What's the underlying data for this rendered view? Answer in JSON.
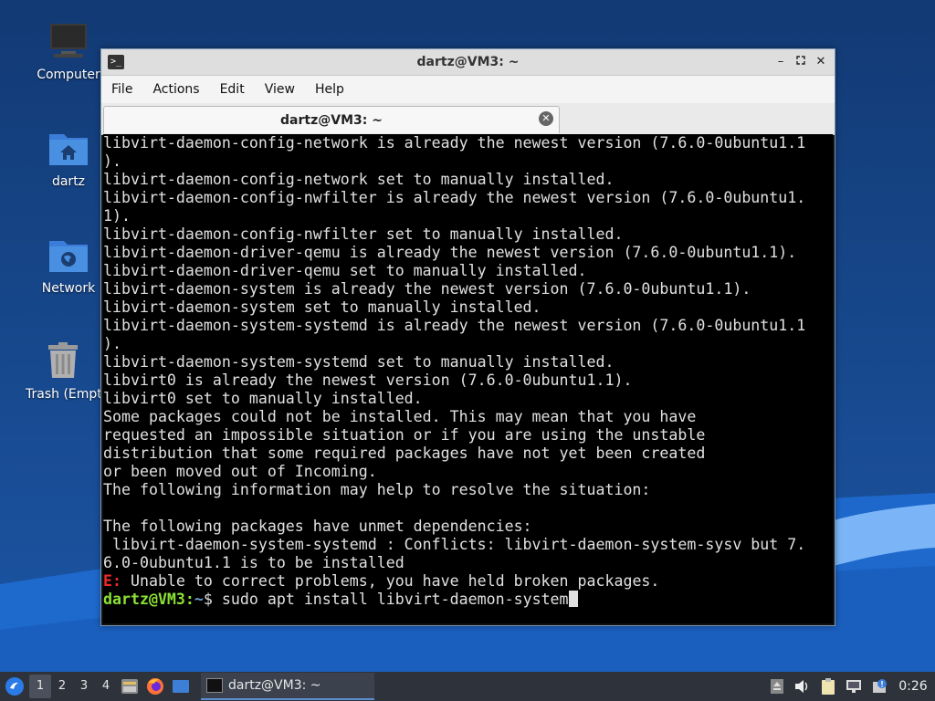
{
  "desktop": {
    "icons": [
      {
        "name": "computer",
        "label": "Computer"
      },
      {
        "name": "home",
        "label": "dartz"
      },
      {
        "name": "network",
        "label": "Network"
      },
      {
        "name": "trash",
        "label": "Trash (Empty)"
      }
    ]
  },
  "window": {
    "title": "dartz@VM3: ~",
    "icon": "terminal-icon",
    "controls": [
      "minimize",
      "maximize",
      "close"
    ],
    "menu": [
      "File",
      "Actions",
      "Edit",
      "View",
      "Help"
    ],
    "tab": {
      "label": "dartz@VM3: ~"
    }
  },
  "terminal": {
    "lines": [
      "libvirt-daemon-config-network is already the newest version (7.6.0-0ubuntu1.1",
      ").",
      "libvirt-daemon-config-network set to manually installed.",
      "libvirt-daemon-config-nwfilter is already the newest version (7.6.0-0ubuntu1.",
      "1).",
      "libvirt-daemon-config-nwfilter set to manually installed.",
      "libvirt-daemon-driver-qemu is already the newest version (7.6.0-0ubuntu1.1).",
      "libvirt-daemon-driver-qemu set to manually installed.",
      "libvirt-daemon-system is already the newest version (7.6.0-0ubuntu1.1).",
      "libvirt-daemon-system set to manually installed.",
      "libvirt-daemon-system-systemd is already the newest version (7.6.0-0ubuntu1.1",
      ").",
      "libvirt-daemon-system-systemd set to manually installed.",
      "libvirt0 is already the newest version (7.6.0-0ubuntu1.1).",
      "libvirt0 set to manually installed.",
      "Some packages could not be installed. This may mean that you have",
      "requested an impossible situation or if you are using the unstable",
      "distribution that some required packages have not yet been created",
      "or been moved out of Incoming.",
      "The following information may help to resolve the situation:",
      "",
      "The following packages have unmet dependencies:",
      " libvirt-daemon-system-systemd : Conflicts: libvirt-daemon-system-sysv but 7.",
      "6.0-0ubuntu1.1 is to be installed"
    ],
    "error_prefix": "E:",
    "error_text": " Unable to correct problems, you have held broken packages.",
    "prompt_user": "dartz@VM3",
    "prompt_colon": ":",
    "prompt_path": "~",
    "prompt_symbol": "$ ",
    "command": "sudo apt install libvirt-daemon-system",
    "colors": {
      "background": "#000000",
      "text": "#e0e0e0",
      "prompt_user": "#8ae234",
      "prompt_path": "#729fcf",
      "error": "#ef2929"
    }
  },
  "taskbar": {
    "workspaces": [
      "1",
      "2",
      "3",
      "4"
    ],
    "active_workspace": "1",
    "launchers": [
      "file-manager-icon",
      "firefox-icon",
      "show-desktop-icon"
    ],
    "task": {
      "label": "dartz@VM3: ~",
      "icon": "terminal-icon"
    },
    "tray": [
      "eject-icon",
      "volume-icon",
      "clipboard-icon",
      "network-icon",
      "update-notifier-icon"
    ],
    "clock": "0:26"
  }
}
